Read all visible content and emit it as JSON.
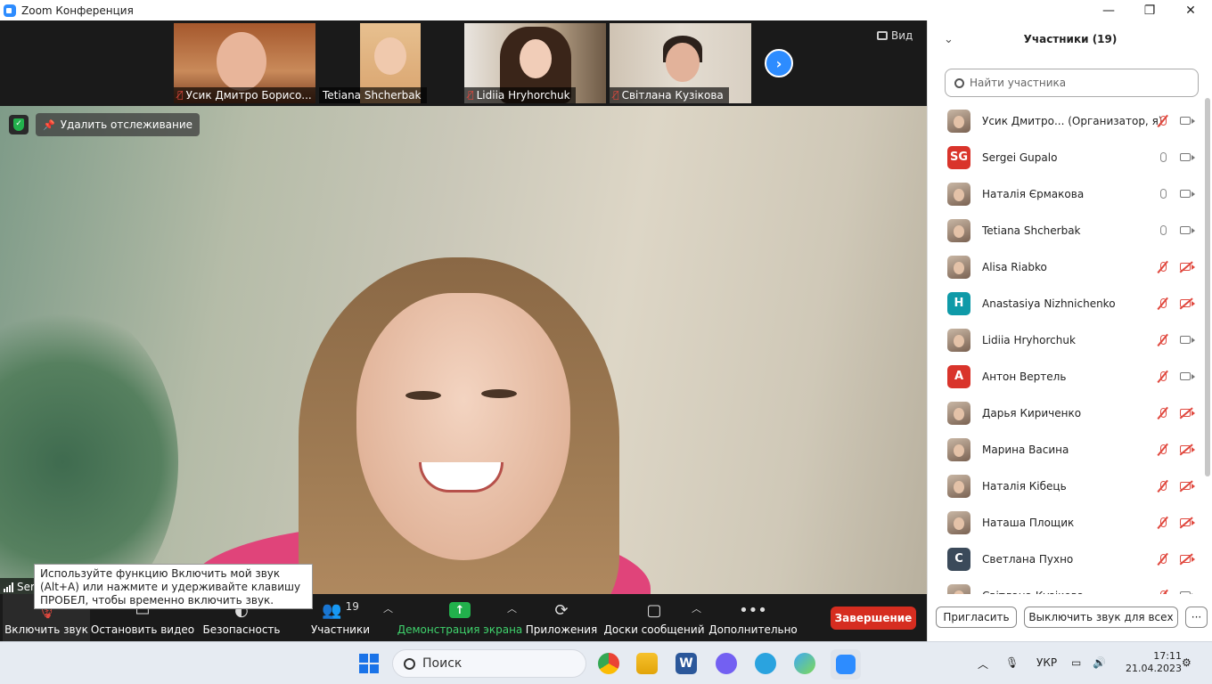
{
  "window": {
    "title": "Zoom Конференция",
    "minimize": "—",
    "maximize": "❐",
    "close": "✕"
  },
  "thumbnails": [
    {
      "name": "Усик Дмитро Борисо...",
      "muted": true
    },
    {
      "name": "Tetiana Shcherbak",
      "muted": false
    },
    {
      "name": "Lidiia Hryhorchuk",
      "muted": true
    },
    {
      "name": "Світлана Кузікова",
      "muted": true
    }
  ],
  "view_button": "Вид",
  "unpin_label": "Удалить отслеживание",
  "speaker_name": "Ser",
  "tooltip": "Используйте функцию Включить мой звук (Alt+A) или нажмите и удерживайте клавишу ПРОБЕЛ, чтобы временно включить звук.",
  "toolbar": {
    "unmute": "Включить звук",
    "stop_video": "Остановить видео",
    "security": "Безопасность",
    "participants": "Участники",
    "participants_count": "19",
    "share_screen": "Демонстрация экрана",
    "apps": "Приложения",
    "whiteboards": "Доски сообщений",
    "more": "Дополнительно",
    "end": "Завершение"
  },
  "panel": {
    "title": "Участники (19)",
    "search_placeholder": "Найти участника",
    "invite": "Пригласить",
    "mute_all": "Выключить звук для всех",
    "more": "···"
  },
  "participants": [
    {
      "name": "Усик Дмитро... (Организатор, я)",
      "avatar_type": "photo",
      "initials": "",
      "color": "",
      "mic": "off",
      "cam": "on"
    },
    {
      "name": "Sergei Gupalo",
      "avatar_type": "initials",
      "initials": "SG",
      "color": "#d9342b",
      "mic": "on",
      "cam": "on"
    },
    {
      "name": "Наталія Єрмакова",
      "avatar_type": "photo",
      "initials": "",
      "color": "",
      "mic": "on",
      "cam": "on"
    },
    {
      "name": "Tetiana Shcherbak",
      "avatar_type": "photo",
      "initials": "",
      "color": "",
      "mic": "on",
      "cam": "on"
    },
    {
      "name": "Alisa Riabko",
      "avatar_type": "photo",
      "initials": "",
      "color": "",
      "mic": "off",
      "cam": "off"
    },
    {
      "name": "Anastasiya Nizhnichenko",
      "avatar_type": "initials",
      "initials": "H",
      "color": "#0f9aa8",
      "mic": "off",
      "cam": "off"
    },
    {
      "name": "Lidiia Hryhorchuk",
      "avatar_type": "photo",
      "initials": "",
      "color": "",
      "mic": "off",
      "cam": "on"
    },
    {
      "name": "Антон Вертель",
      "avatar_type": "initials",
      "initials": "A",
      "color": "#d9342b",
      "mic": "off",
      "cam": "on"
    },
    {
      "name": "Дарья Кириченко",
      "avatar_type": "photo",
      "initials": "",
      "color": "",
      "mic": "off",
      "cam": "off"
    },
    {
      "name": "Марина Васина",
      "avatar_type": "photo",
      "initials": "",
      "color": "",
      "mic": "off",
      "cam": "off"
    },
    {
      "name": "Наталія Кібець",
      "avatar_type": "photo",
      "initials": "",
      "color": "",
      "mic": "off",
      "cam": "off"
    },
    {
      "name": "Наташа Площик",
      "avatar_type": "photo",
      "initials": "",
      "color": "",
      "mic": "off",
      "cam": "off"
    },
    {
      "name": "Светлана Пухно",
      "avatar_type": "initials",
      "initials": "C",
      "color": "#3b4a5a",
      "mic": "off",
      "cam": "off"
    },
    {
      "name": "Світлана Кузікова",
      "avatar_type": "photo",
      "initials": "",
      "color": "",
      "mic": "off",
      "cam": "on"
    }
  ],
  "taskbar": {
    "search": "Поиск",
    "lang": "УКР",
    "time": "17:11",
    "date": "21.04.2023"
  },
  "colors": {
    "zoom_blue": "#2d8cff",
    "end_red": "#d62d20",
    "share_green": "#22b14c",
    "muted_red": "#e0483e"
  }
}
